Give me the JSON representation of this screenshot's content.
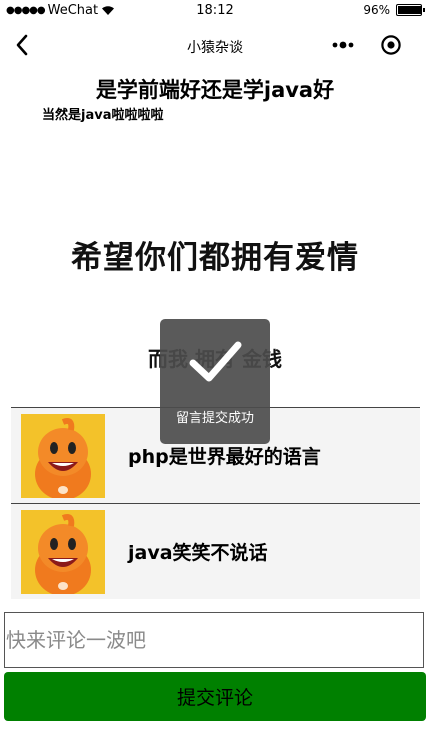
{
  "status_bar": {
    "carrier": "WeChat",
    "time": "18:12",
    "battery": "96%",
    "battery_level": 0.96
  },
  "nav": {
    "title": "小猿杂谈",
    "back_icon": "chevron-left-icon",
    "more_icon": "more-dots-icon",
    "close_icon": "target-close-icon"
  },
  "article": {
    "title": "是学前端好还是学java好",
    "subtitle": "当然是java啦啦啦啦",
    "image_text_line1": "希望你们都拥有爱情",
    "image_text_line2": "而我 拥有 金钱"
  },
  "comments": [
    {
      "text": "php是世界最好的语言",
      "avatar": "orange-mascot-avatar"
    },
    {
      "text": "java笑笑不说话",
      "avatar": "orange-mascot-avatar"
    }
  ],
  "form": {
    "placeholder": "快来评论一波吧",
    "value": "",
    "submit_label": "提交评论",
    "submit_color": "#008000"
  },
  "toast": {
    "text": "留言提交成功",
    "icon": "checkmark-icon"
  }
}
